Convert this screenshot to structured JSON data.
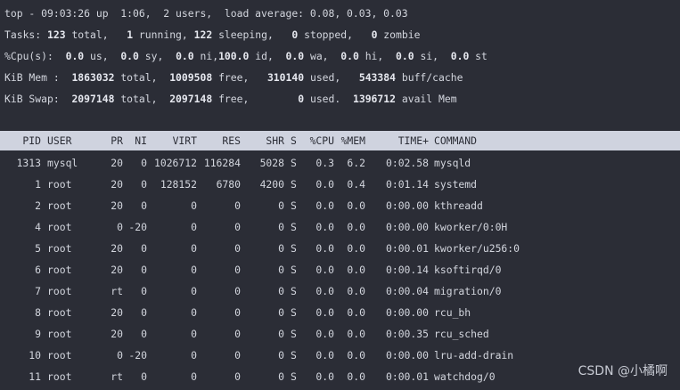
{
  "summary": {
    "line1": "top - 09:03:26 up  1:06,  2 users,  load average: 0.08, 0.03, 0.03",
    "tasks": {
      "label": "Tasks:",
      "total": "123",
      "total_text": "total,",
      "running": "1",
      "running_text": "running,",
      "sleeping": "122",
      "sleeping_text": "sleeping,",
      "stopped": "0",
      "stopped_text": "stopped,",
      "zombie": "0",
      "zombie_text": "zombie"
    },
    "cpu": {
      "label": "%Cpu(s):",
      "us": "0.0",
      "us_text": "us,",
      "sy": "0.0",
      "sy_text": "sy,",
      "ni": "0.0",
      "ni_text": "ni,",
      "id": "100.0",
      "id_text": "id,",
      "wa": "0.0",
      "wa_text": "wa,",
      "hi": "0.0",
      "hi_text": "hi,",
      "si": "0.0",
      "si_text": "si,",
      "st": "0.0",
      "st_text": "st"
    },
    "mem": {
      "label": "KiB Mem :",
      "total": "1863032",
      "total_text": "total,",
      "free": "1009508",
      "free_text": "free,",
      "used": "310140",
      "used_text": "used,",
      "buff": "543384",
      "buff_text": "buff/cache"
    },
    "swap": {
      "label": "KiB Swap:",
      "total": "2097148",
      "total_text": "total,",
      "free": "2097148",
      "free_text": "free,",
      "used": "0",
      "used_text": "used.",
      "avail": "1396712",
      "avail_text": "avail Mem"
    }
  },
  "table": {
    "headers": [
      "PID",
      "USER",
      "PR",
      "NI",
      "VIRT",
      "RES",
      "SHR",
      "S",
      "%CPU",
      "%MEM",
      "TIME+",
      "COMMAND"
    ],
    "rows": [
      [
        "1313",
        "mysql",
        "20",
        "0",
        "1026712",
        "116284",
        "5028",
        "S",
        "0.3",
        "6.2",
        "0:02.58",
        "mysqld"
      ],
      [
        "1",
        "root",
        "20",
        "0",
        "128152",
        "6780",
        "4200",
        "S",
        "0.0",
        "0.4",
        "0:01.14",
        "systemd"
      ],
      [
        "2",
        "root",
        "20",
        "0",
        "0",
        "0",
        "0",
        "S",
        "0.0",
        "0.0",
        "0:00.00",
        "kthreadd"
      ],
      [
        "4",
        "root",
        "0",
        "-20",
        "0",
        "0",
        "0",
        "S",
        "0.0",
        "0.0",
        "0:00.00",
        "kworker/0:0H"
      ],
      [
        "5",
        "root",
        "20",
        "0",
        "0",
        "0",
        "0",
        "S",
        "0.0",
        "0.0",
        "0:00.01",
        "kworker/u256:0"
      ],
      [
        "6",
        "root",
        "20",
        "0",
        "0",
        "0",
        "0",
        "S",
        "0.0",
        "0.0",
        "0:00.14",
        "ksoftirqd/0"
      ],
      [
        "7",
        "root",
        "rt",
        "0",
        "0",
        "0",
        "0",
        "S",
        "0.0",
        "0.0",
        "0:00.04",
        "migration/0"
      ],
      [
        "8",
        "root",
        "20",
        "0",
        "0",
        "0",
        "0",
        "S",
        "0.0",
        "0.0",
        "0:00.00",
        "rcu_bh"
      ],
      [
        "9",
        "root",
        "20",
        "0",
        "0",
        "0",
        "0",
        "S",
        "0.0",
        "0.0",
        "0:00.35",
        "rcu_sched"
      ],
      [
        "10",
        "root",
        "0",
        "-20",
        "0",
        "0",
        "0",
        "S",
        "0.0",
        "0.0",
        "0:00.00",
        "lru-add-drain"
      ],
      [
        "11",
        "root",
        "rt",
        "0",
        "0",
        "0",
        "0",
        "S",
        "0.0",
        "0.0",
        "0:00.01",
        "watchdog/0"
      ]
    ]
  },
  "watermark": "CSDN @小橘啊",
  "colors": {
    "background": "#2b2d36",
    "text": "#d3d6de",
    "header_bar": "#cfd3df"
  }
}
